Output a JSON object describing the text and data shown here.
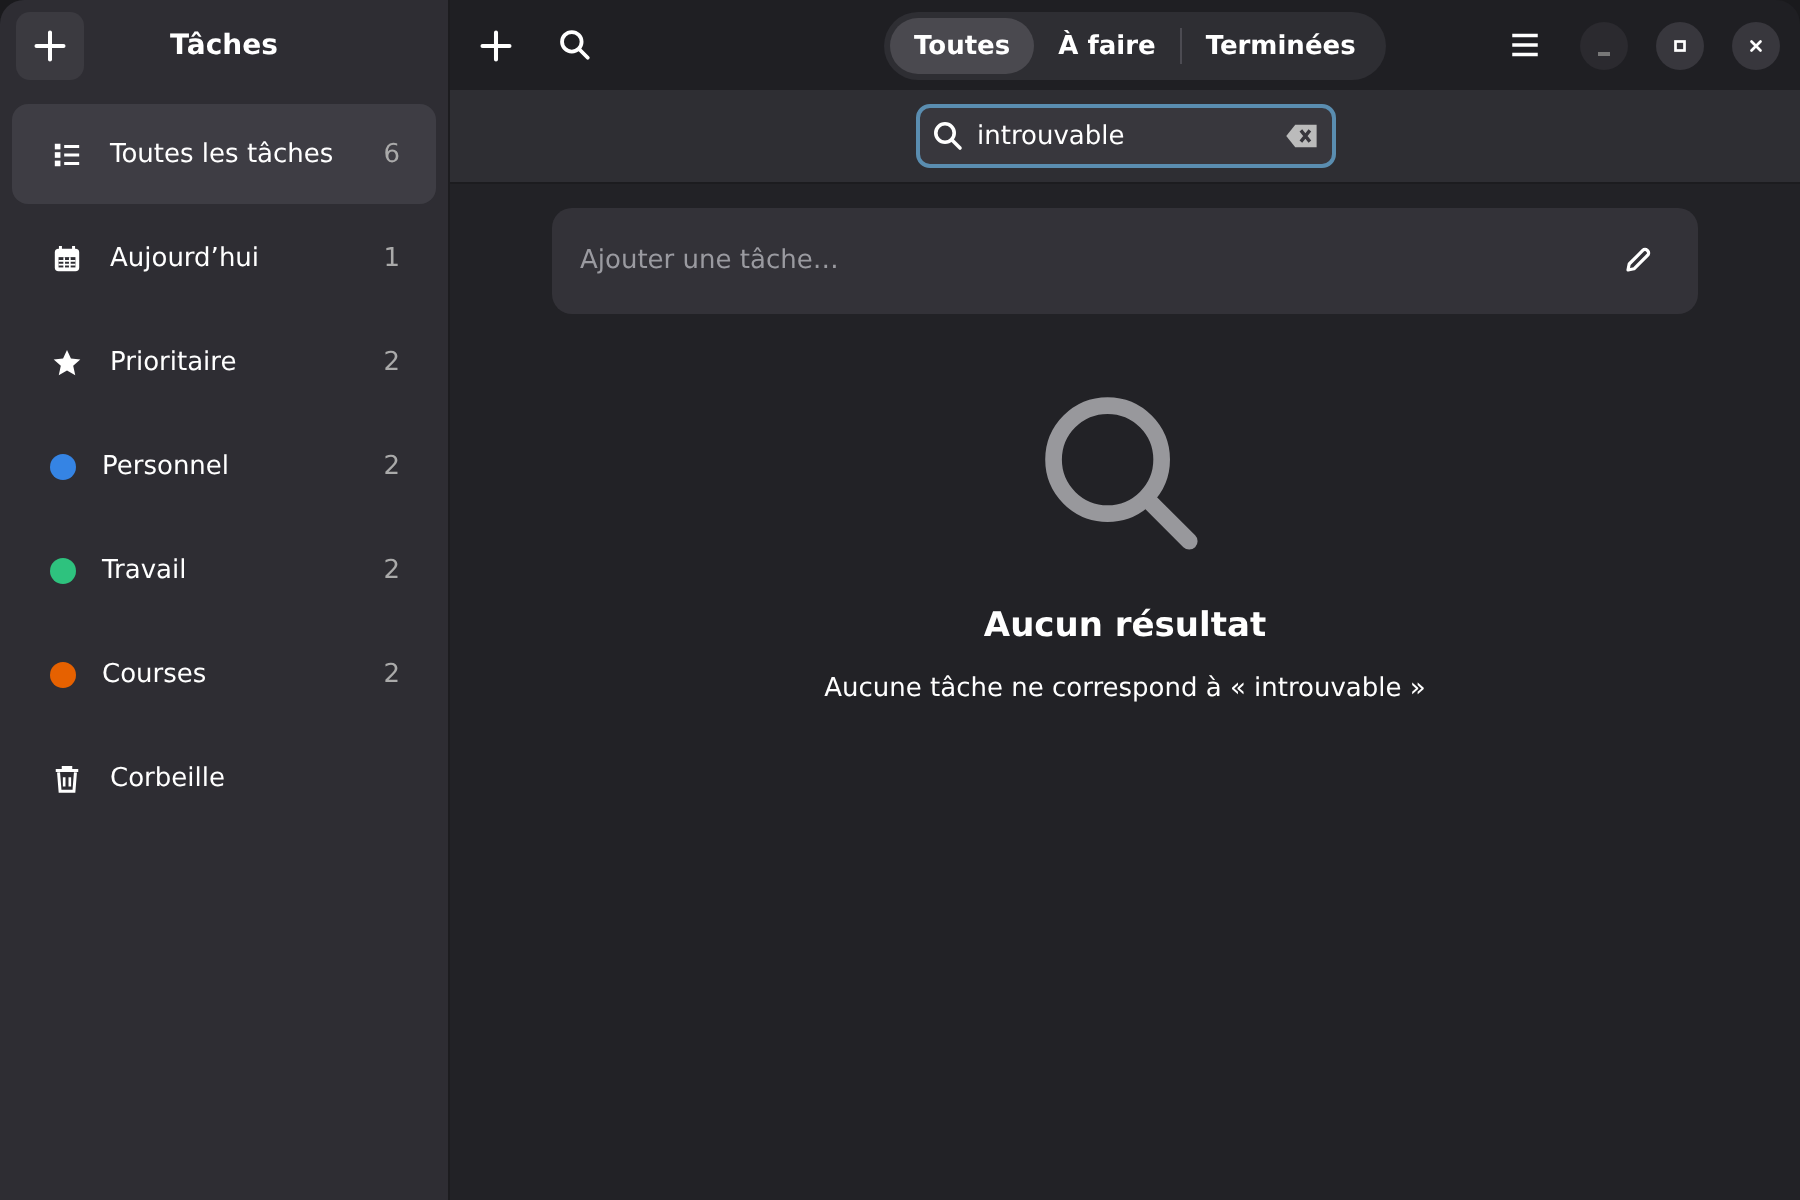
{
  "sidebar": {
    "title": "Tâches",
    "items": [
      {
        "kind": "list",
        "label": "Toutes les tâches",
        "count": "6",
        "selected": true
      },
      {
        "kind": "calendar",
        "label": "Aujourd’hui",
        "count": "1",
        "selected": false
      },
      {
        "kind": "star",
        "label": "Prioritaire",
        "count": "2",
        "selected": false
      },
      {
        "kind": "dot",
        "label": "Personnel",
        "count": "2",
        "color": "#3584e4",
        "selected": false
      },
      {
        "kind": "dot",
        "label": "Travail",
        "count": "2",
        "color": "#2ec27e",
        "selected": false
      },
      {
        "kind": "dot",
        "label": "Courses",
        "count": "2",
        "color": "#e66100",
        "selected": false
      },
      {
        "kind": "trash",
        "label": "Corbeille",
        "selected": false
      }
    ]
  },
  "header": {
    "filters": [
      {
        "label": "Toutes",
        "selected": true
      },
      {
        "label": "À faire",
        "selected": false
      },
      {
        "label": "Terminées",
        "selected": false
      }
    ]
  },
  "search": {
    "value": "introuvable"
  },
  "new_task": {
    "placeholder": "Ajouter une tâche…"
  },
  "empty_state": {
    "title": "Aucun résultat",
    "message": "Aucune tâche ne correspond à « introuvable »"
  }
}
